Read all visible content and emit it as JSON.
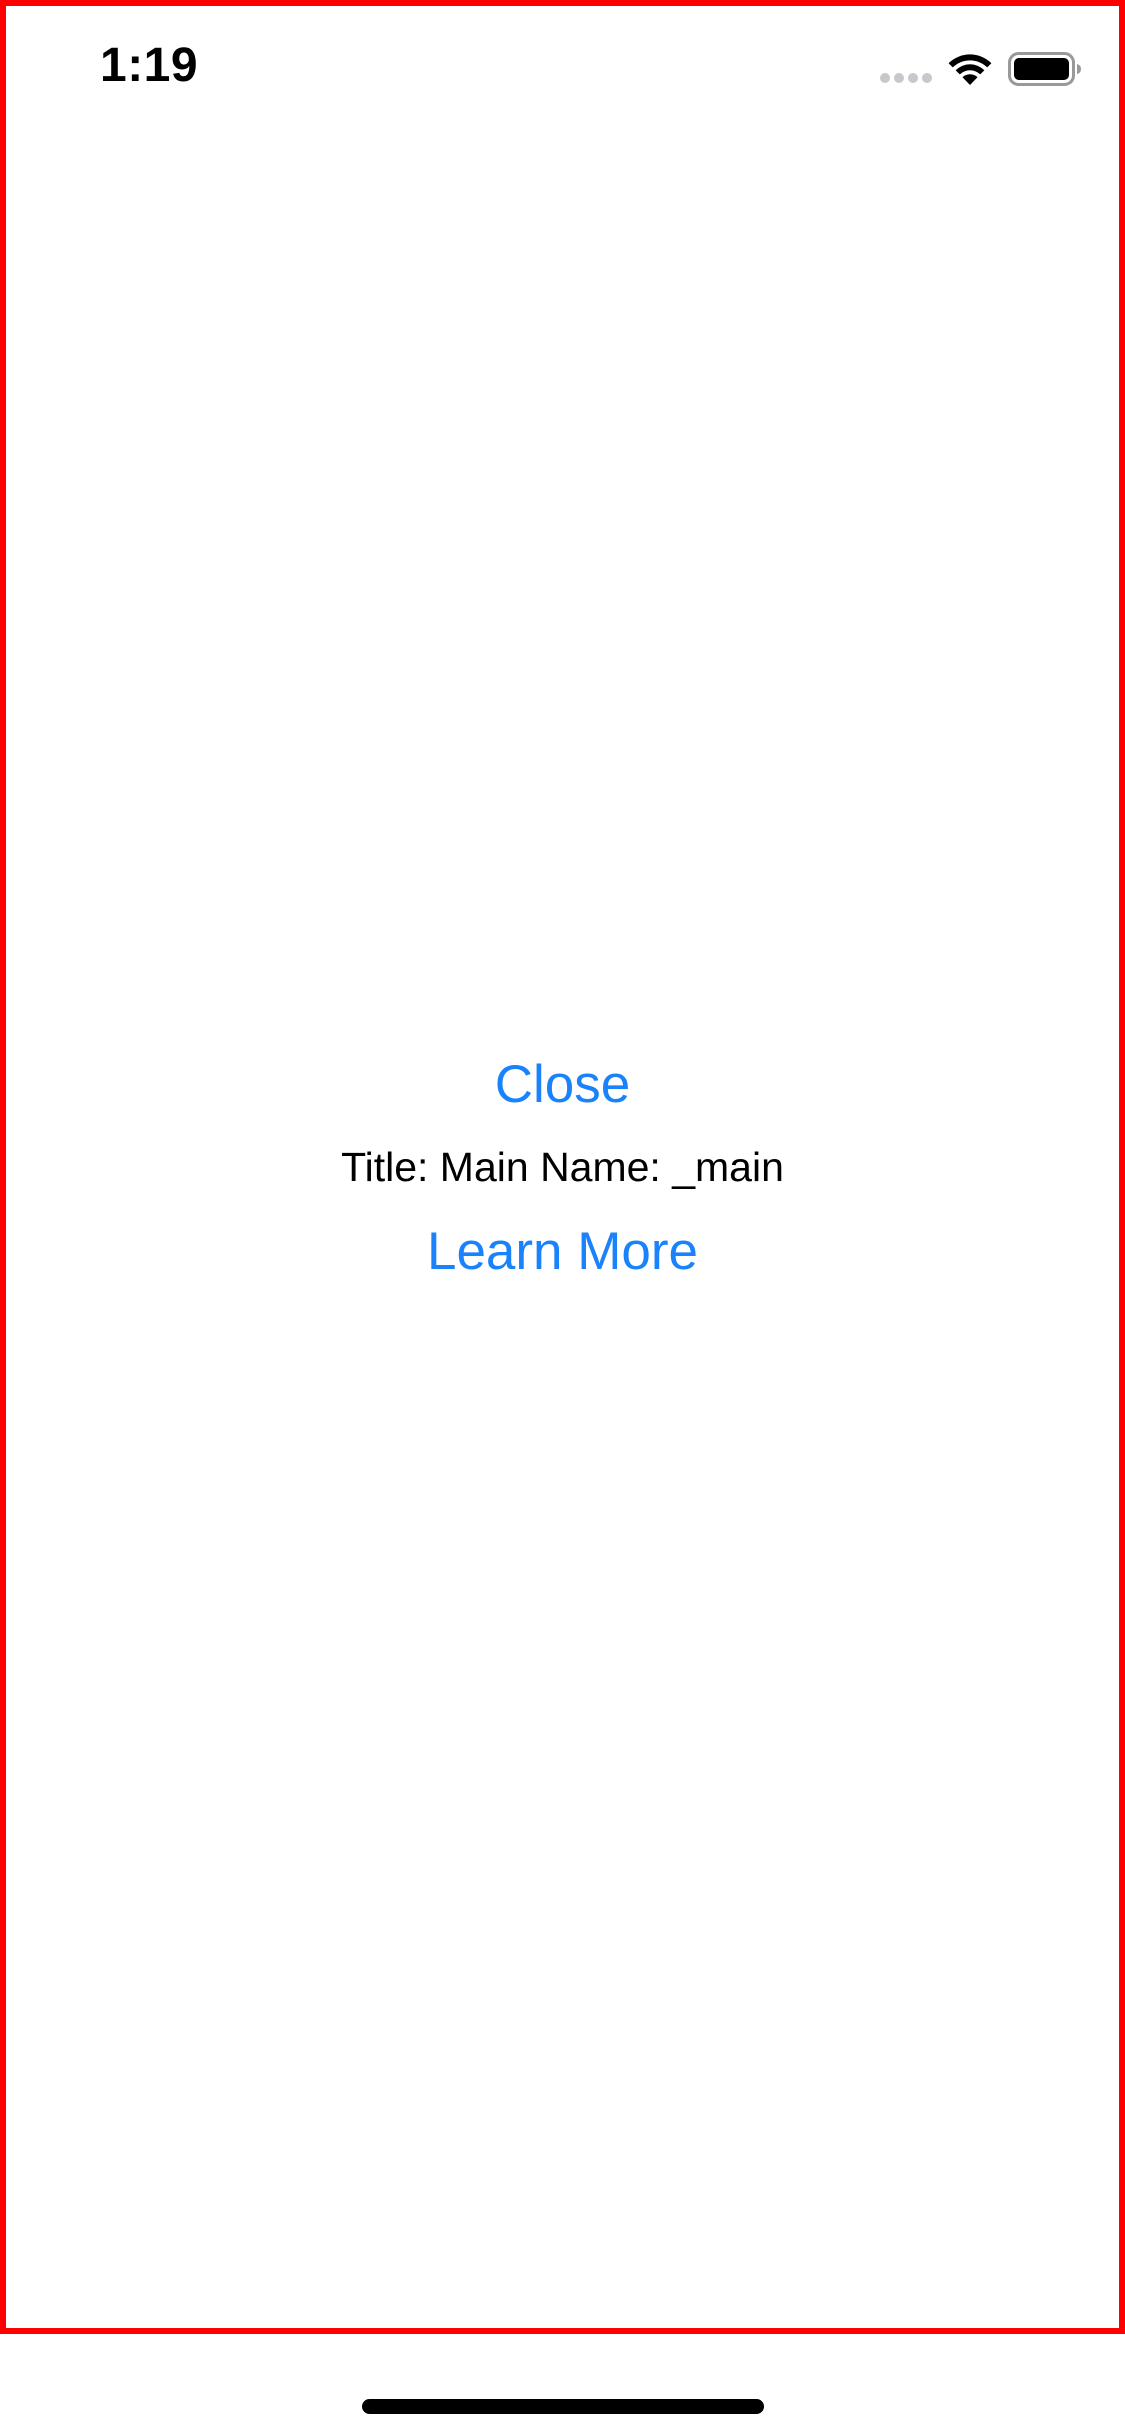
{
  "status_bar": {
    "time": "1:19",
    "icons": [
      "cellular-signal-icon",
      "wifi-icon",
      "battery-icon"
    ]
  },
  "main": {
    "close_label": "Close",
    "info_text": "Title: Main Name: _main",
    "learn_more_label": "Learn More"
  },
  "colors": {
    "accent": "#1a82fb",
    "text": "#000000",
    "background": "#ffffff",
    "debug_frame": "#ff0000"
  }
}
